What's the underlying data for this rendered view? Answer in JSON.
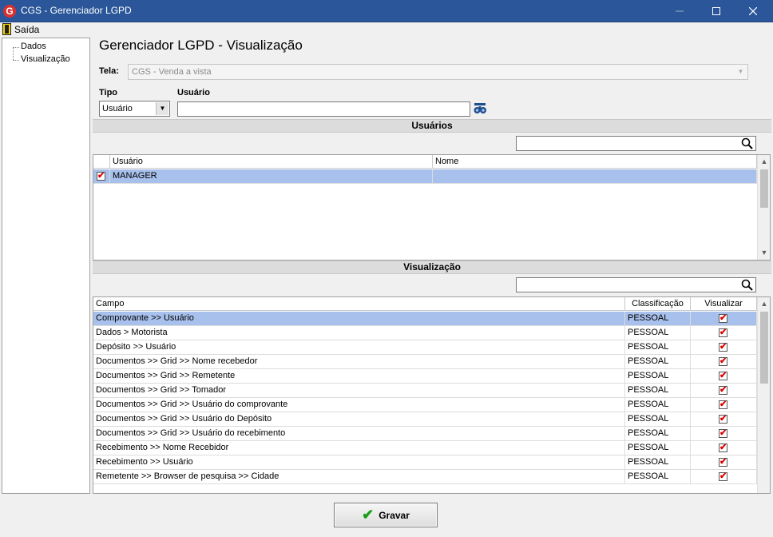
{
  "window": {
    "title": "CGS - Gerenciador LGPD",
    "app_icon": "G"
  },
  "menu": {
    "exit_label": "Saída"
  },
  "sidebar": {
    "items": [
      {
        "label": "Dados"
      },
      {
        "label": "Visualização"
      }
    ]
  },
  "page": {
    "title": "Gerenciador LGPD - Visualização"
  },
  "form": {
    "tela_label": "Tela:",
    "tela_value": "CGS - Venda a vista",
    "tipo_label": "Tipo",
    "tipo_value": "Usuário",
    "usuario_label": "Usuário",
    "usuario_value": ""
  },
  "users_section": {
    "header": "Usuários",
    "search_value": "",
    "columns": [
      "Usuário",
      "Nome"
    ],
    "rows": [
      {
        "checked": true,
        "usuario": "MANAGER",
        "nome": ""
      }
    ]
  },
  "view_section": {
    "header": "Visualização",
    "search_value": "",
    "columns": [
      "Campo",
      "Classificação",
      "Visualizar"
    ],
    "rows": [
      {
        "campo": "Comprovante >> Usuário",
        "classificacao": "PESSOAL",
        "visualizar": true
      },
      {
        "campo": "Dados > Motorista",
        "classificacao": "PESSOAL",
        "visualizar": true
      },
      {
        "campo": "Depósito >> Usuário",
        "classificacao": "PESSOAL",
        "visualizar": true
      },
      {
        "campo": "Documentos >> Grid >> Nome recebedor",
        "classificacao": "PESSOAL",
        "visualizar": true
      },
      {
        "campo": "Documentos >> Grid >> Remetente",
        "classificacao": "PESSOAL",
        "visualizar": true
      },
      {
        "campo": "Documentos >> Grid >> Tomador",
        "classificacao": "PESSOAL",
        "visualizar": true
      },
      {
        "campo": "Documentos >> Grid >> Usuário do comprovante",
        "classificacao": "PESSOAL",
        "visualizar": true
      },
      {
        "campo": "Documentos >> Grid >> Usuário do Depósito",
        "classificacao": "PESSOAL",
        "visualizar": true
      },
      {
        "campo": "Documentos >> Grid >> Usuário do recebimento",
        "classificacao": "PESSOAL",
        "visualizar": true
      },
      {
        "campo": "Recebimento >> Nome Recebidor",
        "classificacao": "PESSOAL",
        "visualizar": true
      },
      {
        "campo": "Recebimento >> Usuário",
        "classificacao": "PESSOAL",
        "visualizar": true
      },
      {
        "campo": "Remetente >> Browser de pesquisa >> Cidade",
        "classificacao": "PESSOAL",
        "visualizar": true
      }
    ]
  },
  "footer": {
    "save_label": "Gravar"
  }
}
